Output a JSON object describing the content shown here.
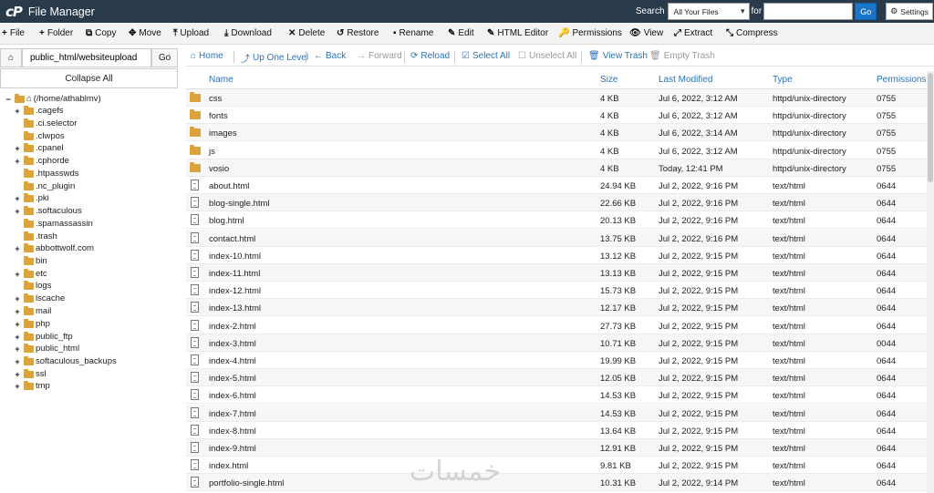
{
  "header": {
    "logo": "cP",
    "title": "File Manager",
    "search_label": "Search",
    "search_scope": "All Your Files",
    "for_label": "for",
    "search_query": "",
    "go_label": "Go",
    "settings_label": "Settings"
  },
  "toolbar": [
    {
      "icon": "+",
      "label": "File",
      "name": "new-file-button"
    },
    {
      "icon": "+",
      "label": "Folder",
      "name": "new-folder-button"
    },
    {
      "icon": "⧉",
      "label": "Copy",
      "name": "copy-button"
    },
    {
      "icon": "✥",
      "label": "Move",
      "name": "move-button"
    },
    {
      "icon": "⤒",
      "label": "Upload",
      "name": "upload-button"
    },
    {
      "icon": "⤓",
      "label": "Download",
      "name": "download-button"
    },
    {
      "icon": "✕",
      "label": "Delete",
      "name": "delete-button"
    },
    {
      "icon": "↺",
      "label": "Restore",
      "name": "restore-button"
    },
    {
      "icon": "▪",
      "label": "Rename",
      "name": "rename-button"
    },
    {
      "icon": "✎",
      "label": "Edit",
      "name": "edit-button"
    },
    {
      "icon": "✎",
      "label": "HTML Editor",
      "name": "html-editor-button"
    },
    {
      "icon": "🔑",
      "label": "Permissions",
      "name": "permissions-button"
    },
    {
      "icon": "👁",
      "label": "View",
      "name": "view-button"
    },
    {
      "icon": "⤢",
      "label": "Extract",
      "name": "extract-button"
    },
    {
      "icon": "⤡",
      "label": "Compress",
      "name": "compress-button"
    }
  ],
  "sidebar": {
    "path_value": "public_html/websiteupload",
    "go_label": "Go",
    "collapse_label": "Collapse All",
    "root_label": "(/home/athablmv)",
    "tree": [
      {
        "label": ".cagefs",
        "toggle": "+"
      },
      {
        "label": ".ci.selector",
        "toggle": ""
      },
      {
        "label": ".clwpos",
        "toggle": ""
      },
      {
        "label": ".cpanel",
        "toggle": "+"
      },
      {
        "label": ".cphorde",
        "toggle": "+"
      },
      {
        "label": ".htpasswds",
        "toggle": ""
      },
      {
        "label": ".nc_plugin",
        "toggle": ""
      },
      {
        "label": ".pki",
        "toggle": "+"
      },
      {
        "label": ".softaculous",
        "toggle": "+"
      },
      {
        "label": ".spamassassin",
        "toggle": ""
      },
      {
        "label": ".trash",
        "toggle": ""
      },
      {
        "label": "abbottwolf.com",
        "toggle": "+"
      },
      {
        "label": "bin",
        "toggle": ""
      },
      {
        "label": "etc",
        "toggle": "+"
      },
      {
        "label": "logs",
        "toggle": ""
      },
      {
        "label": "lscache",
        "toggle": "+"
      },
      {
        "label": "mail",
        "toggle": "+"
      },
      {
        "label": "php",
        "toggle": "+"
      },
      {
        "label": "public_ftp",
        "toggle": "+"
      },
      {
        "label": "public_html",
        "toggle": "+"
      },
      {
        "label": "softaculous_backups",
        "toggle": "+"
      },
      {
        "label": "ssl",
        "toggle": "+"
      },
      {
        "label": "tmp",
        "toggle": "+"
      }
    ]
  },
  "nav": [
    {
      "icon": "⌂",
      "label": "Home",
      "name": "nav-home-button",
      "disabled": false
    },
    {
      "icon": "⤴",
      "label": "Up One Level",
      "name": "nav-up-button",
      "disabled": false
    },
    {
      "icon": "←",
      "label": "Back",
      "name": "nav-back-button",
      "disabled": false
    },
    {
      "icon": "→",
      "label": "Forward",
      "name": "nav-forward-button",
      "disabled": true
    },
    {
      "icon": "⟳",
      "label": "Reload",
      "name": "nav-reload-button",
      "disabled": false
    },
    {
      "icon": "☑",
      "label": "Select All",
      "name": "nav-select-all-button",
      "disabled": false
    },
    {
      "icon": "☐",
      "label": "Unselect All",
      "name": "nav-unselect-all-button",
      "disabled": true
    },
    {
      "icon": "🗑",
      "label": "View Trash",
      "name": "nav-view-trash-button",
      "disabled": false
    },
    {
      "icon": "🗑",
      "label": "Empty Trash",
      "name": "nav-empty-trash-button",
      "disabled": true
    }
  ],
  "table": {
    "columns": [
      "Name",
      "Size",
      "Last Modified",
      "Type",
      "Permissions"
    ],
    "rows": [
      {
        "kind": "folder",
        "name": "css",
        "size": "4 KB",
        "modified": "Jul 6, 2022, 3:12 AM",
        "type": "httpd/unix-directory",
        "perms": "0755"
      },
      {
        "kind": "folder",
        "name": "fonts",
        "size": "4 KB",
        "modified": "Jul 6, 2022, 3:12 AM",
        "type": "httpd/unix-directory",
        "perms": "0755"
      },
      {
        "kind": "folder",
        "name": "images",
        "size": "4 KB",
        "modified": "Jul 6, 2022, 3:14 AM",
        "type": "httpd/unix-directory",
        "perms": "0755"
      },
      {
        "kind": "folder",
        "name": "js",
        "size": "4 KB",
        "modified": "Jul 6, 2022, 3:12 AM",
        "type": "httpd/unix-directory",
        "perms": "0755"
      },
      {
        "kind": "folder",
        "name": "vosio",
        "size": "4 KB",
        "modified": "Today, 12:41 PM",
        "type": "httpd/unix-directory",
        "perms": "0755"
      },
      {
        "kind": "file",
        "name": "about.html",
        "size": "24.94 KB",
        "modified": "Jul 2, 2022, 9:16 PM",
        "type": "text/html",
        "perms": "0644"
      },
      {
        "kind": "file",
        "name": "blog-single.html",
        "size": "22.66 KB",
        "modified": "Jul 2, 2022, 9:16 PM",
        "type": "text/html",
        "perms": "0644"
      },
      {
        "kind": "file",
        "name": "blog.html",
        "size": "20.13 KB",
        "modified": "Jul 2, 2022, 9:16 PM",
        "type": "text/html",
        "perms": "0644"
      },
      {
        "kind": "file",
        "name": "contact.html",
        "size": "13.75 KB",
        "modified": "Jul 2, 2022, 9:16 PM",
        "type": "text/html",
        "perms": "0644"
      },
      {
        "kind": "file",
        "name": "index-10.html",
        "size": "13.12 KB",
        "modified": "Jul 2, 2022, 9:15 PM",
        "type": "text/html",
        "perms": "0644"
      },
      {
        "kind": "file",
        "name": "index-11.html",
        "size": "13.13 KB",
        "modified": "Jul 2, 2022, 9:15 PM",
        "type": "text/html",
        "perms": "0644"
      },
      {
        "kind": "file",
        "name": "index-12.html",
        "size": "15.73 KB",
        "modified": "Jul 2, 2022, 9:15 PM",
        "type": "text/html",
        "perms": "0644"
      },
      {
        "kind": "file",
        "name": "index-13.html",
        "size": "12.17 KB",
        "modified": "Jul 2, 2022, 9:15 PM",
        "type": "text/html",
        "perms": "0644"
      },
      {
        "kind": "file",
        "name": "index-2.html",
        "size": "27.73 KB",
        "modified": "Jul 2, 2022, 9:15 PM",
        "type": "text/html",
        "perms": "0644"
      },
      {
        "kind": "file",
        "name": "index-3.html",
        "size": "10.71 KB",
        "modified": "Jul 2, 2022, 9:15 PM",
        "type": "text/html",
        "perms": "0044"
      },
      {
        "kind": "file",
        "name": "index-4.html",
        "size": "19.99 KB",
        "modified": "Jul 2, 2022, 9:15 PM",
        "type": "text/html",
        "perms": "0644"
      },
      {
        "kind": "file",
        "name": "index-5.html",
        "size": "12.05 KB",
        "modified": "Jul 2, 2022, 9:15 PM",
        "type": "text/html",
        "perms": "0644"
      },
      {
        "kind": "file",
        "name": "index-6.html",
        "size": "14.53 KB",
        "modified": "Jul 2, 2022, 9:15 PM",
        "type": "text/html",
        "perms": "0644"
      },
      {
        "kind": "file",
        "name": "index-7.html",
        "size": "14.53 KB",
        "modified": "Jul 2, 2022, 9:15 PM",
        "type": "text/html",
        "perms": "0644"
      },
      {
        "kind": "file",
        "name": "index-8.html",
        "size": "13.64 KB",
        "modified": "Jul 2, 2022, 9:15 PM",
        "type": "text/html",
        "perms": "0644"
      },
      {
        "kind": "file",
        "name": "index-9.html",
        "size": "12.91 KB",
        "modified": "Jul 2, 2022, 9:15 PM",
        "type": "text/html",
        "perms": "0644"
      },
      {
        "kind": "file",
        "name": "index.html",
        "size": "9.81 KB",
        "modified": "Jul 2, 2022, 9:15 PM",
        "type": "text/html",
        "perms": "0644"
      },
      {
        "kind": "file",
        "name": "portfolio-single.html",
        "size": "10.31 KB",
        "modified": "Jul 2, 2022, 9:14 PM",
        "type": "text/html",
        "perms": "0644"
      }
    ]
  },
  "watermark": "خمسات",
  "colors": {
    "header_bg": "#293a4a",
    "link": "#2a73b8",
    "folder": "#d9a43d",
    "go_button": "#1b76c9"
  }
}
